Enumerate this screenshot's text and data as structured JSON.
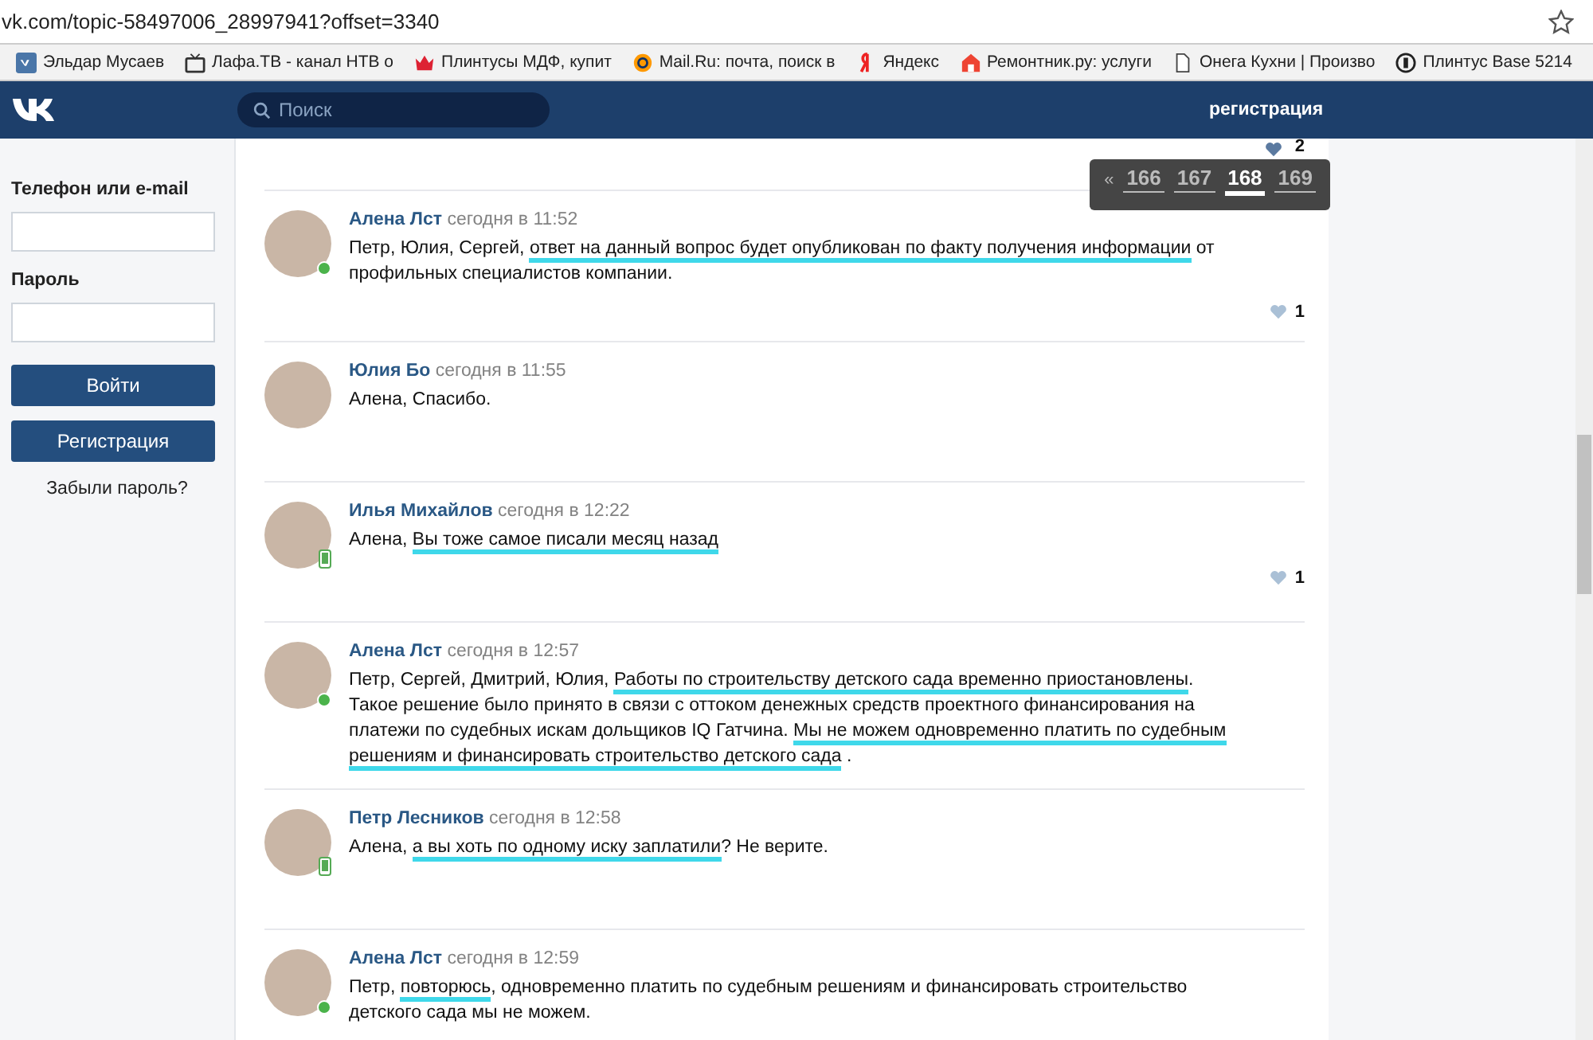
{
  "browser": {
    "url": "vk.com/topic-58497006_28997941?offset=3340",
    "bookmarks": [
      {
        "kind": "vk",
        "label": "Эльдар Мусаев"
      },
      {
        "kind": "tv",
        "label": "Лафа.ТВ - канал НТВ о"
      },
      {
        "kind": "crown",
        "label": "Плинтусы МДФ, купит"
      },
      {
        "kind": "at",
        "label": "Mail.Ru: почта, поиск в"
      },
      {
        "kind": "ya",
        "label": "Яндекс"
      },
      {
        "kind": "house",
        "label": "Ремонтник.ру: услуги"
      },
      {
        "kind": "page",
        "label": "Онега Кухни | Произво"
      },
      {
        "kind": "ring",
        "label": "Плинтус Base 5214"
      }
    ]
  },
  "header": {
    "search_placeholder": "Поиск",
    "register_link": "регистрация"
  },
  "login": {
    "phone_label": "Телефон или e-mail",
    "password_label": "Пароль",
    "login_button": "Войти",
    "register_button": "Регистрация",
    "forgot_link": "Забыли пароль?"
  },
  "pagination": {
    "prev": "«",
    "pages": [
      {
        "label": "166",
        "selected": false
      },
      {
        "label": "167",
        "selected": false
      },
      {
        "label": "168",
        "selected": true
      },
      {
        "label": "169",
        "selected": false
      }
    ]
  },
  "previous_post_likes": "2",
  "posts": [
    {
      "author": "Алена Лст",
      "time": "сегодня в 11:52",
      "online": true,
      "mobile": false,
      "likes": "1",
      "text": [
        {
          "text": "Петр, Юлия, Сергей, ",
          "highlighted": false
        },
        {
          "text": "ответ на данный вопрос будет опубликован по факту получения информации",
          "highlighted": true
        },
        {
          "text": " от профильных специалистов компании.",
          "highlighted": false
        }
      ]
    },
    {
      "author": "Юлия Бо",
      "time": "сегодня в 11:55",
      "online": false,
      "mobile": false,
      "text": [
        {
          "text": "Алена, Спасибо.",
          "highlighted": false
        }
      ]
    },
    {
      "author": "Илья Михайлов",
      "time": "сегодня в 12:22",
      "online": false,
      "mobile": true,
      "likes": "1",
      "text": [
        {
          "text": "Алена, ",
          "highlighted": false
        },
        {
          "text": "Вы тоже самое писали месяц назад",
          "highlighted": true
        }
      ]
    },
    {
      "author": "Алена Лст",
      "time": "сегодня в 12:57",
      "online": true,
      "mobile": false,
      "text": [
        {
          "text": "Петр, Сергей, Дмитрий, Юлия, ",
          "highlighted": false
        },
        {
          "text": "Работы по строительству детского сада временно приостановлены",
          "highlighted": true
        },
        {
          "text": ". Такое решение было принято в связи с оттоком денежных средств проектного финансирования на платежи по судебных искам дольщиков IQ Гатчина. ",
          "highlighted": false
        },
        {
          "text": "Мы не можем одновременно платить по судебным решениям и финансировать строительство детского сада",
          "highlighted": true
        },
        {
          "text": " .",
          "highlighted": false
        }
      ]
    },
    {
      "author": "Петр Лесников",
      "time": "сегодня в 12:58",
      "online": false,
      "mobile": true,
      "text": [
        {
          "text": "Алена, ",
          "highlighted": false
        },
        {
          "text": "а вы хоть по одному иску заплатили",
          "highlighted": true
        },
        {
          "text": "? Не верите.",
          "highlighted": false
        }
      ]
    },
    {
      "author": "Алена Лст",
      "time": "сегодня в 12:59",
      "online": true,
      "mobile": false,
      "text": [
        {
          "text": "Петр, ",
          "highlighted": false
        },
        {
          "text": "повторюсь",
          "highlighted": true
        },
        {
          "text": ", одновременно платить по судебным решениям и финансировать строительство детского сада мы не можем.",
          "highlighted": false
        }
      ]
    }
  ]
}
